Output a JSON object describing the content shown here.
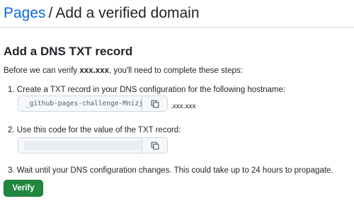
{
  "breadcrumb": {
    "parent": "Pages",
    "separator": "/",
    "current": "Add a verified domain"
  },
  "section": {
    "title": "Add a DNS TXT record",
    "intro_prefix": "Before we can verify ",
    "intro_domain": "xxx.xxx",
    "intro_suffix": ", you'll need to complete these steps:"
  },
  "steps": [
    {
      "text": "1. Create a TXT record in your DNS configuration for the following hostname:"
    },
    {
      "text": "2. Use this code for the value of the TXT record:"
    },
    {
      "text": "3. Wait until your DNS configuration changes. This could take up to 24 hours to propagate."
    }
  ],
  "hostname": {
    "value": "_github-pages-challenge-Mnizjc",
    "domain_suffix": ".xxx.xxx"
  },
  "verify_button": {
    "label": "Verify",
    "color": "#1f883d"
  },
  "colors": {
    "link": "#0969da",
    "text": "#1f2328",
    "border": "#d0d7de"
  },
  "icons": {
    "copy": "copy-icon"
  }
}
